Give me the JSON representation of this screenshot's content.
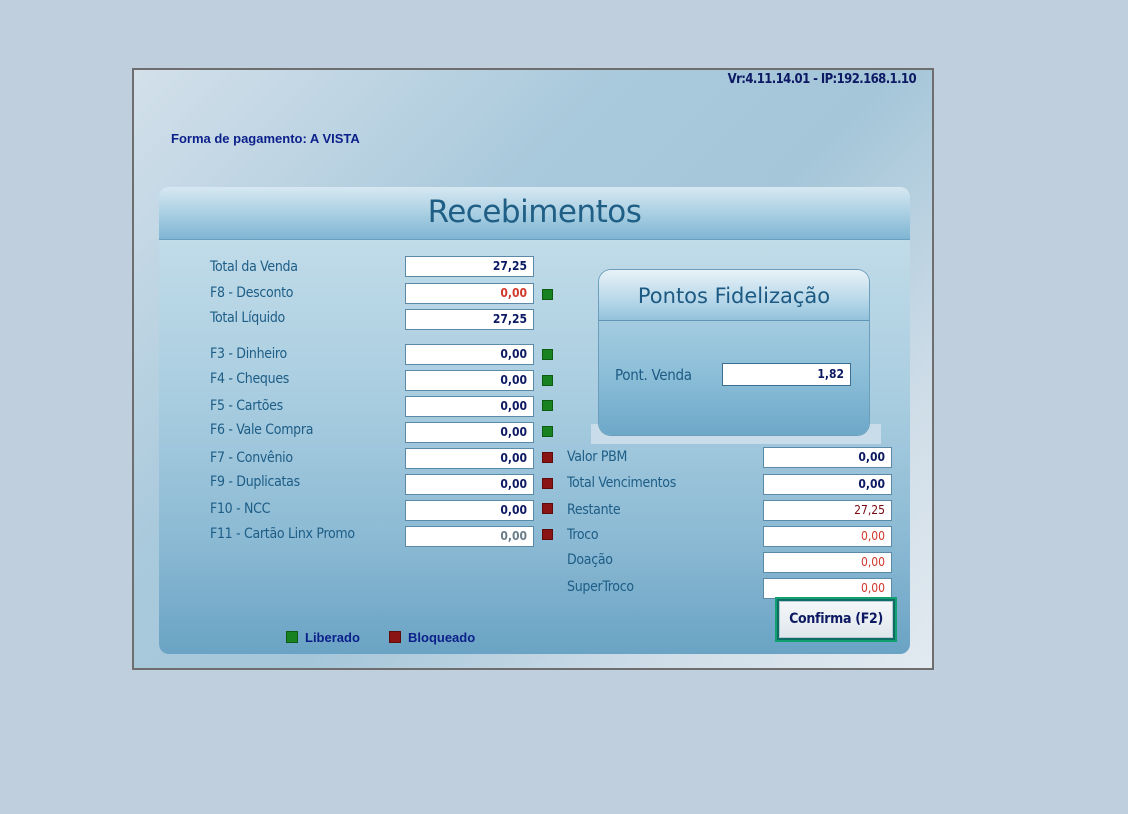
{
  "header": {
    "version": "Vr:4.11.14.01 - IP:192.168.1.10",
    "payment_form": "Forma de pagamento: A VISTA"
  },
  "panel": {
    "title": "Recebimentos"
  },
  "left_rows": [
    {
      "label": "Total da Venda",
      "value": "27,25",
      "value_color": "#0d1a63",
      "indicator": null
    },
    {
      "label": "F8 - Desconto",
      "value": "0,00",
      "value_color": "#d2382b",
      "indicator": "liberado"
    },
    {
      "label": "Total Líquido",
      "value": "27,25",
      "value_color": "#0d1a63",
      "indicator": null
    },
    {
      "label": "F3 - Dinheiro",
      "value": "0,00",
      "value_color": "#0d1a63",
      "indicator": "liberado"
    },
    {
      "label": "F4 - Cheques",
      "value": "0,00",
      "value_color": "#0d1a63",
      "indicator": "liberado"
    },
    {
      "label": "F5 - Cartões",
      "value": "0,00",
      "value_color": "#0d1a63",
      "indicator": "liberado"
    },
    {
      "label": "F6 - Vale Compra",
      "value": "0,00",
      "value_color": "#0d1a63",
      "indicator": "liberado"
    },
    {
      "label": "F7 - Convênio",
      "value": "0,00",
      "value_color": "#0d1a63",
      "indicator": "bloqueado"
    },
    {
      "label": "F9 - Duplicatas",
      "value": "0,00",
      "value_color": "#0d1a63",
      "indicator": "bloqueado"
    },
    {
      "label": "F10 - NCC",
      "value": "0,00",
      "value_color": "#0d1a63",
      "indicator": "bloqueado"
    },
    {
      "label": "F11 - Cartão Linx Promo",
      "value": "0,00",
      "value_color": "#6b7d8a",
      "indicator": "bloqueado"
    }
  ],
  "points": {
    "title": "Pontos Fidelização",
    "label": "Pont. Venda",
    "value": "1,82"
  },
  "right_rows": [
    {
      "label": "Valor PBM",
      "value": "0,00",
      "value_color": "#0d1a63"
    },
    {
      "label": "Total Vencimentos",
      "value": "0,00",
      "value_color": "#0d1a63"
    },
    {
      "label": "Restante",
      "value": "27,25",
      "value_color": "#7a0a12"
    },
    {
      "label": "Troco",
      "value": "0,00",
      "value_color": "#d2382b"
    },
    {
      "label": "Doação",
      "value": "0,00",
      "value_color": "#d2382b"
    },
    {
      "label": "SuperTroco",
      "value": "0,00",
      "value_color": "#d2382b"
    }
  ],
  "confirm_label": "Confirma (F2)",
  "legend": {
    "liberado": "Liberado",
    "bloqueado": "Bloqueado",
    "liberado_color": "#17821f",
    "bloqueado_color": "#8a1414"
  }
}
